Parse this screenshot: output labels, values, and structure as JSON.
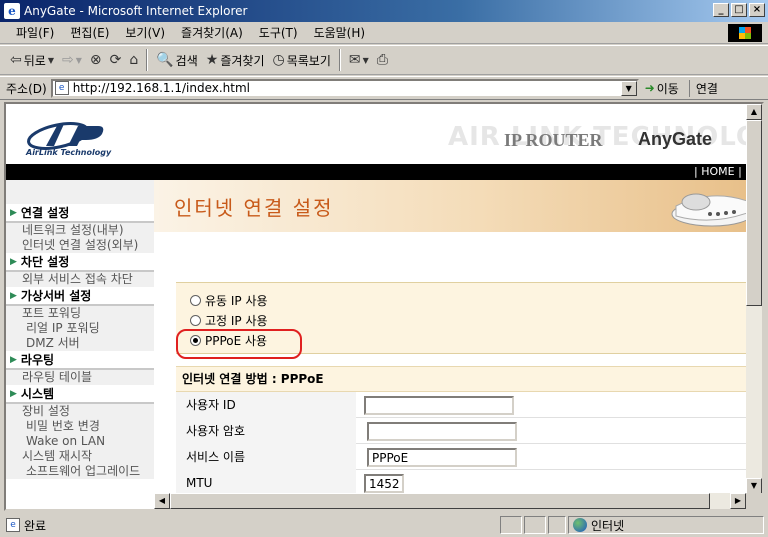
{
  "window": {
    "title": "AnyGate - Microsoft Internet Explorer",
    "controls": [
      "_",
      "□",
      "×"
    ]
  },
  "menu": [
    "파일(F)",
    "편집(E)",
    "보기(V)",
    "즐겨찾기(A)",
    "도구(T)",
    "도움말(H)"
  ],
  "toolbar": {
    "back": "뒤로",
    "search": "검색",
    "favorites": "즐겨찾기",
    "history": "목록보기"
  },
  "address": {
    "label": "주소(D)",
    "url": "http://192.168.1.1/index.html",
    "go": "이동",
    "links": "연결"
  },
  "header": {
    "logo_text": "AirLink Technology",
    "watermark": "AIR LINK TECHNOLOGY",
    "product_type": "IP ROUTER",
    "product_name": "AnyGate",
    "topnav": "| HOME | MA"
  },
  "sidebar": {
    "sections": [
      {
        "title": "연결 설정",
        "links": [
          "네트워크 설정(내부)",
          "인터넷 연결 설정(외부)"
        ]
      },
      {
        "title": "차단 설정",
        "links": [
          "외부 서비스 접속 차단"
        ]
      },
      {
        "title": "가상서버 설정",
        "links": [
          "포트 포워딩",
          "리얼 IP 포워딩",
          "DMZ 서버"
        ]
      },
      {
        "title": "라우팅",
        "links": [
          "라우팅 테이블"
        ]
      },
      {
        "title": "시스템",
        "links": [
          "장비 설정",
          "비밀 번호 변경",
          "Wake on LAN",
          "시스템 재시작",
          "소프트웨어 업그레이드"
        ]
      }
    ]
  },
  "content": {
    "page_title": "인터넷 연결 설정",
    "options": [
      {
        "label": "유동 IP 사용",
        "selected": false
      },
      {
        "label": "고정 IP 사용",
        "selected": false
      },
      {
        "label": "PPPoE 사용",
        "selected": true
      }
    ],
    "method_title": "인터넷 연결 방법 : PPPoE",
    "fields": [
      {
        "label": "사용자 ID",
        "value": ""
      },
      {
        "label": "사용자 암호",
        "value": ""
      },
      {
        "label": "서비스 이름",
        "value": "PPPoE"
      },
      {
        "label": "MTU",
        "value": "1452"
      }
    ]
  },
  "status": {
    "text": "완료",
    "zone": "인터넷"
  }
}
